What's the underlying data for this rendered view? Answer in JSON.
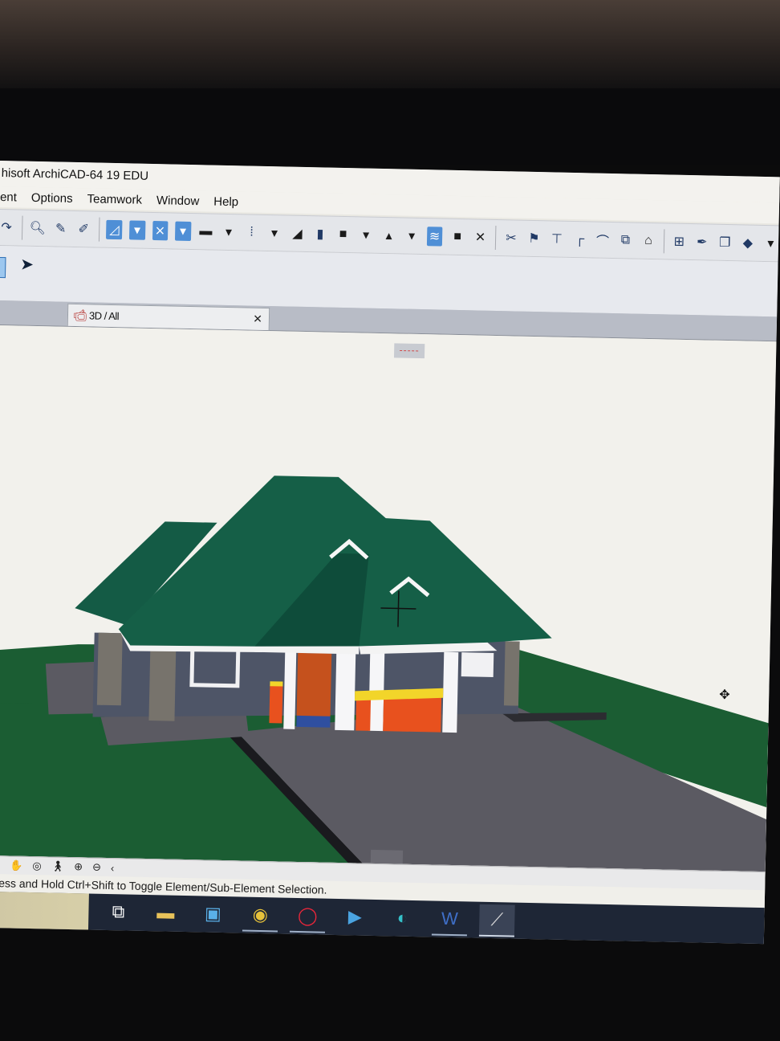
{
  "window": {
    "title": "hisoft ArchiCAD-64 19 EDU"
  },
  "menu": [
    "ent",
    "Options",
    "Teamwork",
    "Window",
    "Help"
  ],
  "toolbar": {
    "icons": [
      "undo-icon",
      "zoom-icon",
      "eyedropper-icon",
      "syringe-icon",
      "layer-pointer-icon",
      "dropdown-icon",
      "snap-icon",
      "dropdown-icon",
      "wall-icon",
      "dropdown-icon",
      "grid-icon",
      "dropdown-icon",
      "slab-icon",
      "column-icon",
      "box-icon",
      "dropdown-icon",
      "object-icon",
      "dropdown-icon",
      "stair-icon",
      "dark-box-icon",
      "close-x-icon",
      "scissors-icon",
      "flag-icon",
      "level-icon",
      "corner-icon",
      "curve-icon",
      "camera-icon",
      "house-icon",
      "schedule-icon",
      "pen-icon",
      "copy-icon",
      "render-icon",
      "dropdown-icon"
    ]
  },
  "tab": {
    "label": "3D / All"
  },
  "status": {
    "text": "Press and Hold Ctrl+Shift to Toggle Element/Sub-Element Selection."
  },
  "colors": {
    "roof": "#145b45",
    "ground": "#1b5d33",
    "paving": "#5b5a62",
    "wall": "#4e5567",
    "stone": "#77736c",
    "railing_orange": "#e8511e",
    "railing_yellow": "#f2d52a"
  }
}
